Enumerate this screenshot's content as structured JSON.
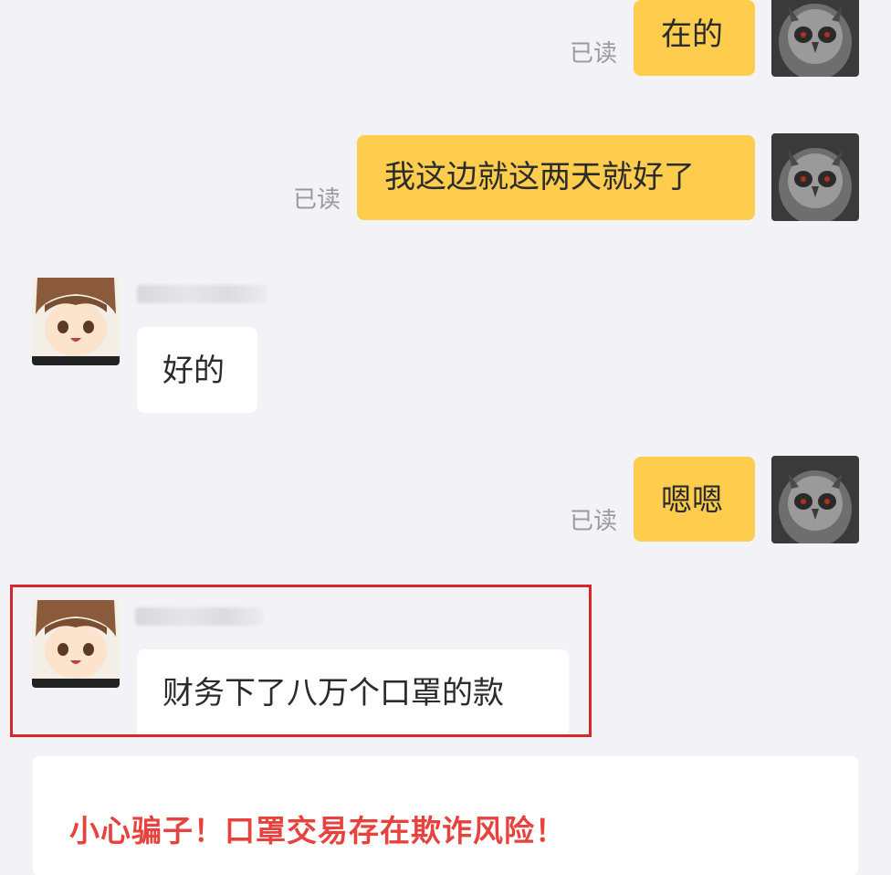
{
  "colors": {
    "background": "#f2f2f7",
    "my_bubble": "#fecd4d",
    "their_bubble": "#ffffff",
    "read_mark": "#9a9a9a",
    "highlight_border": "#d8262a",
    "warning_text": "#e8423e"
  },
  "messages": [
    {
      "from": "me",
      "text": "在的",
      "read_status": "已读",
      "avatar": "owl-avatar"
    },
    {
      "from": "me",
      "text": "我这边就这两天就好了",
      "read_status": "已读",
      "avatar": "owl-avatar"
    },
    {
      "from": "them",
      "text": "好的",
      "avatar": "anime-girl-avatar"
    },
    {
      "from": "me",
      "text": "嗯嗯",
      "read_status": "已读",
      "avatar": "owl-avatar"
    },
    {
      "from": "them",
      "text": "财务下了八万个口罩的款",
      "avatar": "anime-girl-avatar",
      "highlighted": true
    }
  ],
  "warning": {
    "text": "小心骗子！口罩交易存在欺诈风险！"
  }
}
